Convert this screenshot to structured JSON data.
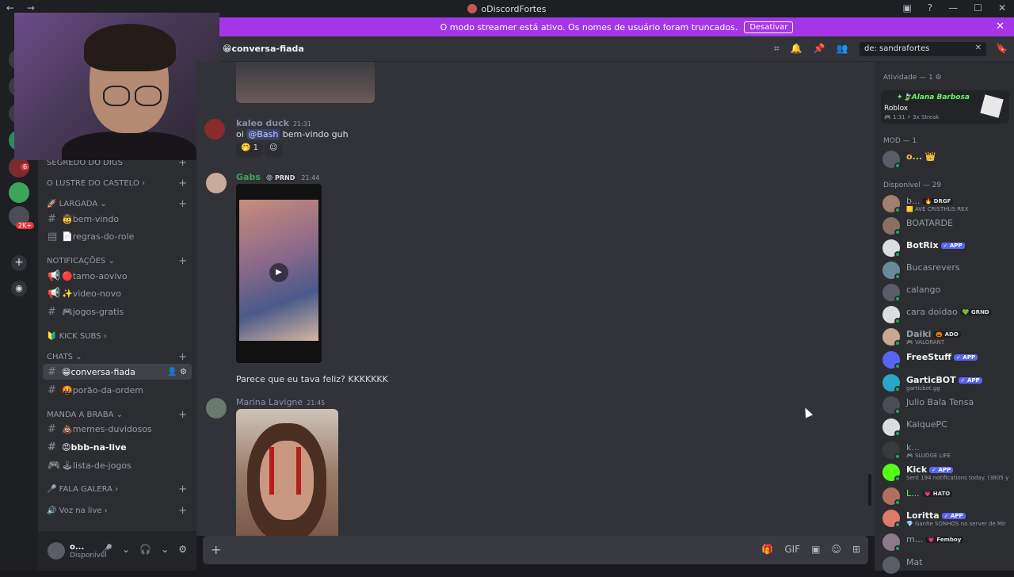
{
  "titlebar": {
    "nav": "← →",
    "title": "oDiscordFortes",
    "controls": [
      "▣",
      "?",
      "—",
      "☐",
      "✕"
    ]
  },
  "banner": {
    "text": "O modo streamer está ativo. Os nomes de usuário foram truncados.",
    "button": "Desativar",
    "close": "✕"
  },
  "rail": {
    "badges": [
      "6",
      "2K+"
    ],
    "add": "+",
    "explore": "◉"
  },
  "channels": {
    "categories": [
      {
        "label": "SEGREDO DO DIGS",
        "plus": "+"
      },
      {
        "label": "O LUSTRE DO CASTELO ›",
        "plus": "+"
      },
      {
        "label": "🚀 LARGADA ⌄",
        "plus": "+"
      },
      {
        "label": "NOTIFICAÇÕES ⌄",
        "plus": "+"
      },
      {
        "label": "🔰 KICK SUBS ›",
        "plus": "+"
      },
      {
        "label": "CHATS ⌄",
        "plus": "+"
      },
      {
        "label": "MANDA A BRABA ⌄",
        "plus": "+"
      },
      {
        "label": "🎤 FALA GALERA ›",
        "plus": "+"
      },
      {
        "label": "🔊 Voz na live ›",
        "plus": "+"
      }
    ],
    "items": [
      {
        "icon": "#",
        "label": "🤠bem-vindo"
      },
      {
        "icon": "▤",
        "label": "📄regras-do-role"
      },
      {
        "icon": "📢",
        "label": "🔴tamo-aovivo"
      },
      {
        "icon": "📢",
        "label": "✨video-novo"
      },
      {
        "icon": "#",
        "label": "🎮jogos-gratis"
      },
      {
        "icon": "#",
        "label": "😁conversa-fiada",
        "tools": "👤 ⚙"
      },
      {
        "icon": "#",
        "label": "🤬porão-da-ordem"
      },
      {
        "icon": "#",
        "label": "💩memes-duvidosos"
      },
      {
        "icon": "#",
        "label": "😡bbb-na-live"
      },
      {
        "icon": "🎮",
        "label": "🕹lista-de-jogos"
      }
    ]
  },
  "user": {
    "name": "o...",
    "status": "Disponível",
    "controls": [
      "🎤",
      "⌄",
      "🎧",
      "⌄",
      "⚙"
    ]
  },
  "chat": {
    "channel": "😁conversa-fiada",
    "header_icons": [
      "⌗",
      "🔔",
      "📌",
      "👥"
    ],
    "search": "de: sandrafortes",
    "search_clear": "✕",
    "bookmark": "🔖",
    "messages": [
      {
        "user": "kaleo duck",
        "time": "21:31",
        "text_before": "oi ",
        "mention": "@Bash",
        "text_after": " bem-vindo guh",
        "reactions": [
          "🤭 1",
          "☺"
        ]
      },
      {
        "user": "Gabs",
        "tag": "😡 PRND",
        "time": "21:44",
        "text": "Parece que eu tava feliz? KKKKKKK"
      },
      {
        "user": "Marina Lavigne",
        "time": "21:45"
      }
    ],
    "composer": {
      "add": "+",
      "tools": [
        "🎁",
        "GIF",
        "▣",
        "☺",
        "⊞"
      ]
    }
  },
  "members": {
    "sections": [
      "Atividade — 1 ⚙",
      "MOD — 1",
      "Disponível — 29"
    ],
    "activity": {
      "user": "✦🍃Alana Barbosa",
      "game": "Roblox",
      "meta": "🎮 1:31  ⚡ 3x Streak"
    },
    "mod": {
      "name": "o... 👑"
    },
    "list": [
      {
        "name": "b...",
        "tag": "🔥 DRGF",
        "sub": "🟨 AVE CRISTHUS REX"
      },
      {
        "name": "BOATARDE"
      },
      {
        "name": "BotRix",
        "app": "✓ APP"
      },
      {
        "name": "Bucasrevers"
      },
      {
        "name": "calango"
      },
      {
        "name": "cara doidao",
        "tag": "💚 GRND"
      },
      {
        "name": "Daiki",
        "tag": "🎃 ADO",
        "sub": "🎮 VALORANT"
      },
      {
        "name": "FreeStuff",
        "app": "✓ APP"
      },
      {
        "name": "GarticBOT",
        "app": "✓ APP",
        "sub": "garticbot.gg"
      },
      {
        "name": "Julio Bala Tensa"
      },
      {
        "name": "KaiquePC"
      },
      {
        "name": "k...",
        "sub": "🎮 SLUDGE LIFE"
      },
      {
        "name": "Kick",
        "app": "✓ APP",
        "sub": "Sent 194 notifications today. (3805 y"
      },
      {
        "name": "L...",
        "tag": "💗 HATO"
      },
      {
        "name": "Loritta",
        "app": "✓ APP",
        "sub": "💎 Ganhe SONHOS no server de Mir"
      },
      {
        "name": "m...",
        "tag": "💗 Femboy"
      },
      {
        "name": "Mat"
      }
    ]
  }
}
